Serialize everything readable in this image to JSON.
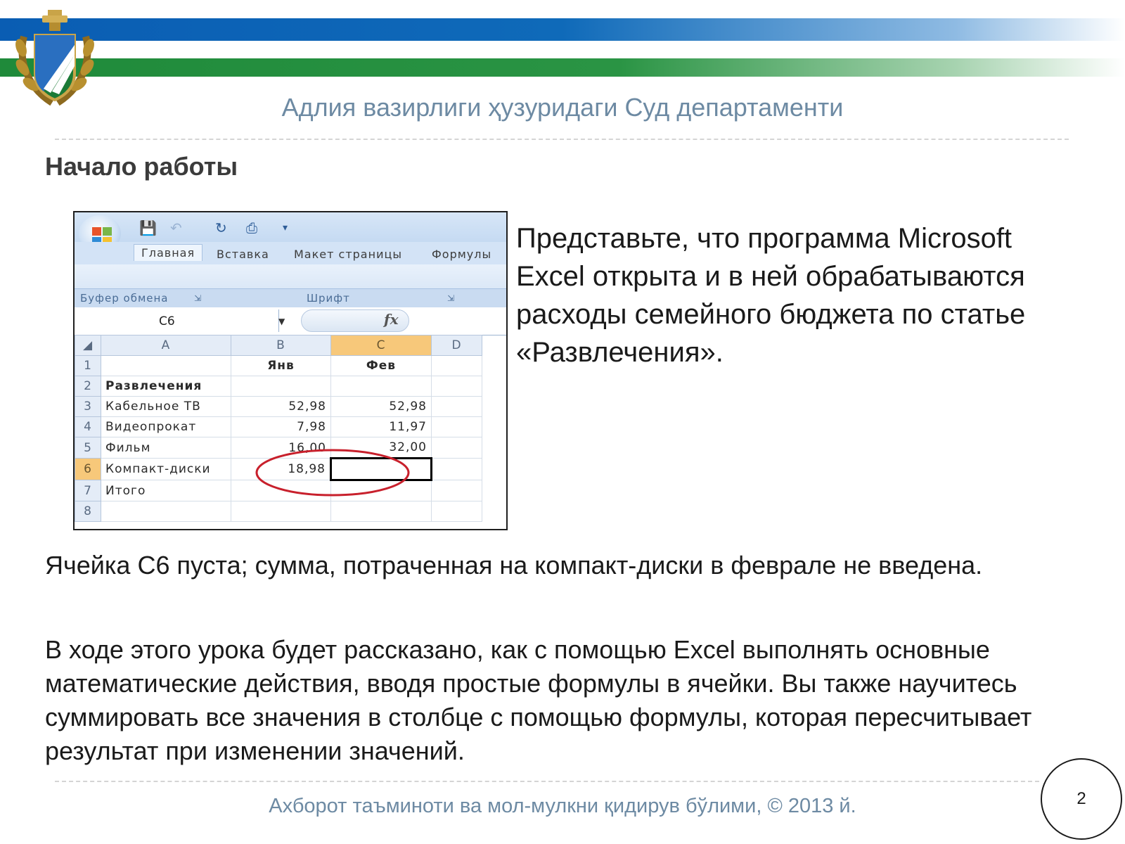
{
  "header": {
    "org_title": "Адлия вазирлиги ҳузуридаги Суд департаменти",
    "brand_blue": "#0a5db3",
    "brand_green": "#1f8a3a",
    "emblem_icon": "coat-of-arms-emblem"
  },
  "slide": {
    "title": "Начало работы",
    "intro": "Представьте, что программа Microsoft Excel открыта и в ней обрабатываются расходы семейного бюджета по статье «Развлечения».",
    "paragraph1": "Ячейка С6 пуста; сумма, потраченная на компакт-диски в феврале не введена.",
    "paragraph2": "В ходе этого урока будет рассказано, как с помощью Excel выполнять основные математические действия, вводя простые формулы в ячейки. Вы также научитесь суммировать все значения в столбце с помощью формулы, которая пересчитывает результат при изменении значений."
  },
  "excel": {
    "tabs": [
      "Главная",
      "Вставка",
      "Макет страницы",
      "Формулы"
    ],
    "groups": [
      "Буфер обмена",
      "Шрифт"
    ],
    "name_box": "C6",
    "fx_label": "fx",
    "columns": [
      "A",
      "B",
      "C",
      "D"
    ],
    "rows": [
      {
        "num": "1",
        "a": "",
        "b": "Янв",
        "c": "Фев"
      },
      {
        "num": "2",
        "a": "Развлечения",
        "b": "",
        "c": ""
      },
      {
        "num": "3",
        "a": "Кабельное ТВ",
        "b": "52,98",
        "c": "52,98"
      },
      {
        "num": "4",
        "a": "Видеопрокат",
        "b": "7,98",
        "c": "11,97"
      },
      {
        "num": "5",
        "a": "Фильм",
        "b": "16,00",
        "c": "32,00"
      },
      {
        "num": "6",
        "a": "Компакт-диски",
        "b": "18,98",
        "c": ""
      },
      {
        "num": "7",
        "a": "Итого",
        "b": "",
        "c": ""
      },
      {
        "num": "8",
        "a": "",
        "b": "",
        "c": ""
      }
    ],
    "selected_cell": "C6",
    "highlight_color": "#c8202c"
  },
  "footer": {
    "text": "Ахборот таъминоти ва мол-мулкни қидирув бўлими, © 2013 й.",
    "page_number": "2"
  }
}
